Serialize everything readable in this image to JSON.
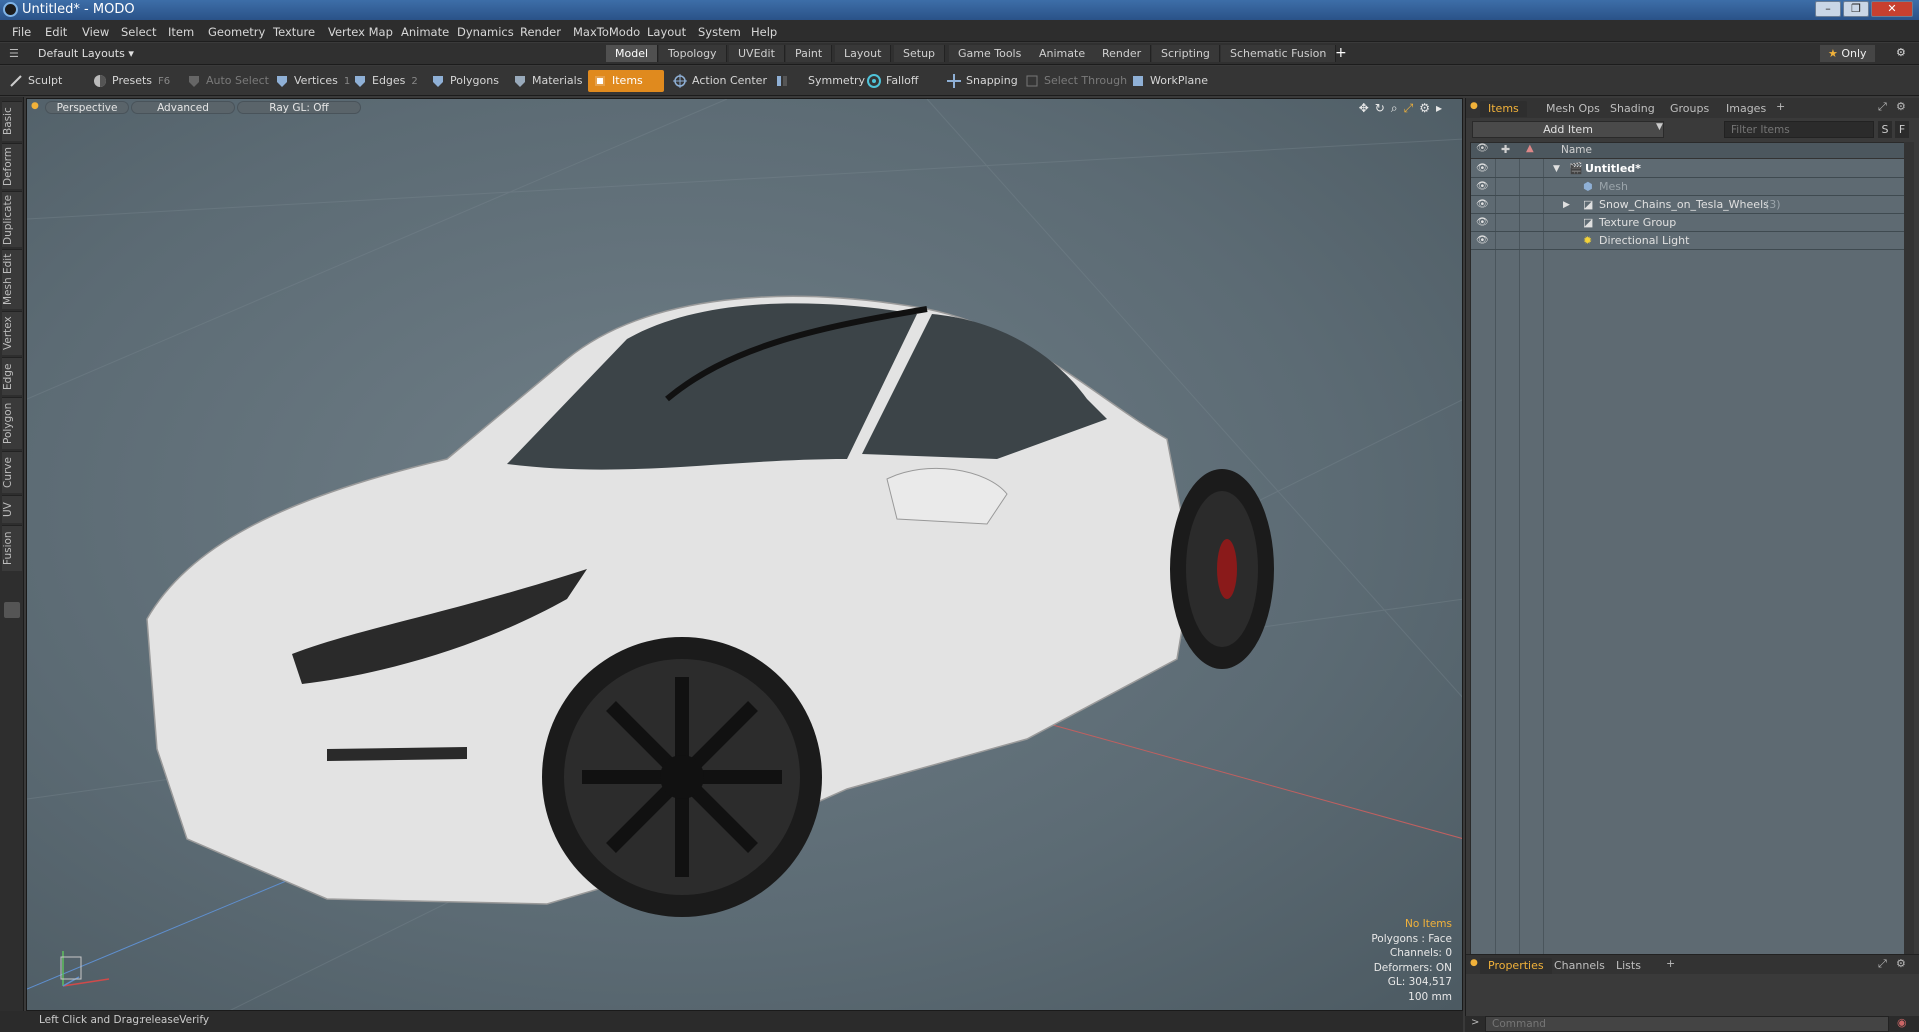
{
  "window": {
    "title": "Untitled* - MODO"
  },
  "menu": [
    "File",
    "Edit",
    "View",
    "Select",
    "Item",
    "Geometry",
    "Texture",
    "Vertex Map",
    "Animate",
    "Dynamics",
    "Render",
    "MaxToModo",
    "Layout",
    "System",
    "Help"
  ],
  "layout_selector": "Default Layouts",
  "layout_tabs": [
    "Model",
    "Topology",
    "UVEdit",
    "Paint",
    "Layout",
    "Setup",
    "Game Tools",
    "Animate",
    "Render",
    "Scripting",
    "Schematic Fusion"
  ],
  "active_layout_tab": "Model",
  "only_label": "Only",
  "toolbar": {
    "sculpt": "Sculpt",
    "presets": "Presets",
    "presets_key": "F6",
    "auto_select": "Auto Select",
    "vertices": "Vertices",
    "vertices_key": "1",
    "edges": "Edges",
    "edges_key": "2",
    "polygons": "Polygons",
    "materials": "Materials",
    "items": "Items",
    "action_center": "Action Center",
    "symmetry": "Symmetry",
    "falloff": "Falloff",
    "snapping": "Snapping",
    "select_through": "Select Through",
    "workplane": "WorkPlane"
  },
  "left_tabs": [
    "Basic",
    "Deform",
    "Duplicate",
    "Mesh Edit",
    "Vertex",
    "Edge",
    "Polygon",
    "Curve",
    "UV",
    "Fusion"
  ],
  "viewport": {
    "projection": "Perspective",
    "shading": "Advanced",
    "raygl": "Ray GL: Off",
    "info": {
      "no_items": "No Items",
      "polygons": "Polygons : Face",
      "channels": "Channels: 0",
      "deformers": "Deformers: ON",
      "gl": "GL: 304,517",
      "scale": "100 mm"
    }
  },
  "panel": {
    "tabs": [
      "Items",
      "Mesh Ops",
      "Shading",
      "Groups",
      "Images"
    ],
    "add_item": "Add Item",
    "filter_placeholder": "Filter Items",
    "filter_btn_s": "S",
    "filter_btn_f": "F",
    "column_name": "Name",
    "tree": [
      {
        "label": "Untitled*",
        "bold": true
      },
      {
        "label": "Mesh",
        "dim": true
      },
      {
        "label": "Snow_Chains_on_Tesla_Wheels",
        "count": "(3)"
      },
      {
        "label": "Texture Group"
      },
      {
        "label": "Directional Light"
      }
    ],
    "bottom_tabs": [
      "Properties",
      "Channels",
      "Lists"
    ],
    "command_placeholder": "Command"
  },
  "status": {
    "left": "Left Click and Drag:",
    "right": "releaseVerify"
  }
}
